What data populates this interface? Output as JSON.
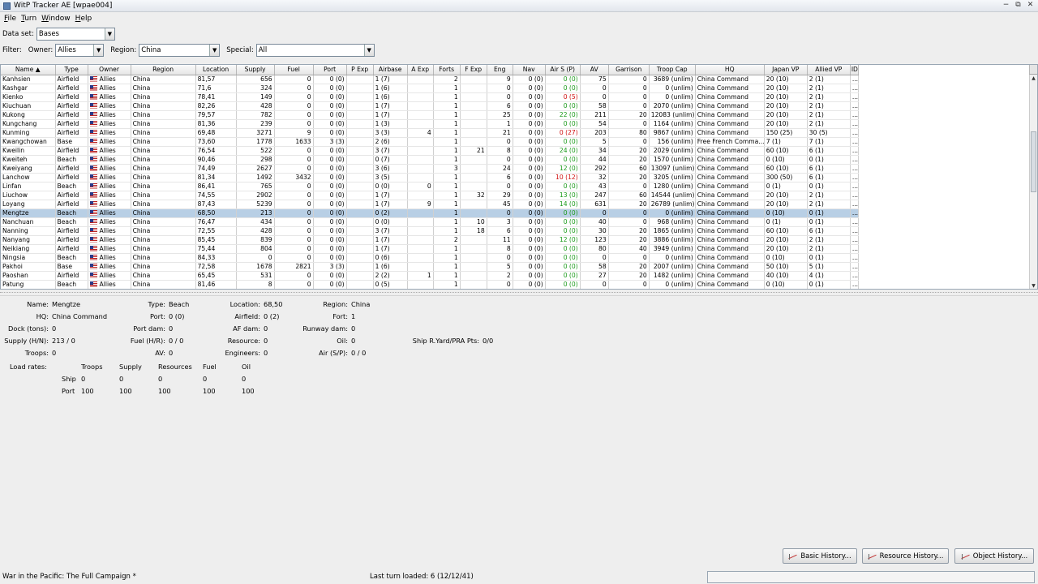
{
  "window": {
    "title": "WitP Tracker AE [wpae004]"
  },
  "menu": {
    "items": [
      "File",
      "Turn",
      "Window",
      "Help"
    ]
  },
  "dataset": {
    "label": "Data set:",
    "value": "Bases"
  },
  "filter": {
    "label": "Filter:",
    "owner_label": "Owner:",
    "owner_value": "Allies",
    "region_label": "Region:",
    "region_value": "China",
    "special_label": "Special:",
    "special_value": "All"
  },
  "table": {
    "columns": [
      "Name ▲",
      "Type",
      "Owner",
      "Region",
      "Location",
      "Supply",
      "Fuel",
      "Port",
      "P Exp",
      "Airbase",
      "A Exp",
      "Forts",
      "F Exp",
      "Eng",
      "Nav",
      "Air S (P)",
      "AV",
      "Garrison",
      "Troop Cap",
      "HQ",
      "Japan VP",
      "Allied VP",
      "ID"
    ],
    "rows": [
      [
        "Kanhsien",
        "Airfield",
        "Allies",
        "China",
        "81,57",
        "656",
        "0",
        "0 (0)",
        "",
        "1 (7)",
        "",
        "2",
        "",
        "9",
        "0 (0)",
        "0 (0)",
        "75",
        "0",
        "3689 (unlim)",
        "China Command",
        "20 (10)",
        "2 (1)",
        "..."
      ],
      [
        "Kashgar",
        "Airfield",
        "Allies",
        "China",
        "71,6",
        "324",
        "0",
        "0 (0)",
        "",
        "1 (6)",
        "",
        "1",
        "",
        "0",
        "0 (0)",
        "0 (0)",
        "0",
        "0",
        "0 (unlim)",
        "China Command",
        "20 (10)",
        "2 (1)",
        "..."
      ],
      [
        "Kienko",
        "Airfield",
        "Allies",
        "China",
        "78,41",
        "149",
        "0",
        "0 (0)",
        "",
        "1 (6)",
        "",
        "1",
        "",
        "0",
        "0 (0)",
        "0 (5)",
        "0",
        "0",
        "0 (unlim)",
        "China Command",
        "20 (10)",
        "2 (1)",
        "..."
      ],
      [
        "Kiuchuan",
        "Airfield",
        "Allies",
        "China",
        "82,26",
        "428",
        "0",
        "0 (0)",
        "",
        "1 (7)",
        "",
        "1",
        "",
        "6",
        "0 (0)",
        "0 (0)",
        "58",
        "0",
        "2070 (unlim)",
        "China Command",
        "20 (10)",
        "2 (1)",
        "..."
      ],
      [
        "Kukong",
        "Airfield",
        "Allies",
        "China",
        "79,57",
        "782",
        "0",
        "0 (0)",
        "",
        "1 (7)",
        "",
        "1",
        "",
        "25",
        "0 (0)",
        "22 (0)",
        "211",
        "20",
        "12083 (unlim)",
        "China Command",
        "20 (10)",
        "2 (1)",
        "..."
      ],
      [
        "Kungchang",
        "Airfield",
        "Allies",
        "China",
        "81,36",
        "239",
        "0",
        "0 (0)",
        "",
        "1 (3)",
        "",
        "1",
        "",
        "1",
        "0 (0)",
        "0 (0)",
        "54",
        "0",
        "1164 (unlim)",
        "China Command",
        "20 (10)",
        "2 (1)",
        "..."
      ],
      [
        "Kunming",
        "Airfield",
        "Allies",
        "China",
        "69,48",
        "3271",
        "9",
        "0 (0)",
        "",
        "3 (3)",
        "4",
        "1",
        "",
        "21",
        "0 (0)",
        "0 (27)",
        "203",
        "80",
        "9867 (unlim)",
        "China Command",
        "150 (25)",
        "30 (5)",
        "..."
      ],
      [
        "Kwangchowan",
        "Base",
        "Allies",
        "China",
        "73,60",
        "1778",
        "1633",
        "3 (3)",
        "",
        "2 (6)",
        "",
        "1",
        "",
        "0",
        "0 (0)",
        "0 (0)",
        "5",
        "0",
        "156 (unlim)",
        "Free French Comma...",
        "7 (1)",
        "7 (1)",
        "..."
      ],
      [
        "Kweilin",
        "Airfield",
        "Allies",
        "China",
        "76,54",
        "522",
        "0",
        "0 (0)",
        "",
        "3 (7)",
        "",
        "1",
        "21",
        "8",
        "0 (0)",
        "24 (0)",
        "34",
        "20",
        "2029 (unlim)",
        "China Command",
        "60 (10)",
        "6 (1)",
        "..."
      ],
      [
        "Kweiteh",
        "Beach",
        "Allies",
        "China",
        "90,46",
        "298",
        "0",
        "0 (0)",
        "",
        "0 (7)",
        "",
        "1",
        "",
        "0",
        "0 (0)",
        "0 (0)",
        "44",
        "20",
        "1570 (unlim)",
        "China Command",
        "0 (10)",
        "0 (1)",
        "..."
      ],
      [
        "Kweiyang",
        "Airfield",
        "Allies",
        "China",
        "74,49",
        "2627",
        "0",
        "0 (0)",
        "",
        "3 (6)",
        "",
        "3",
        "",
        "24",
        "0 (0)",
        "12 (0)",
        "292",
        "60",
        "13097 (unlim)",
        "China Command",
        "60 (10)",
        "6 (1)",
        "..."
      ],
      [
        "Lanchow",
        "Airfield",
        "Allies",
        "China",
        "81,34",
        "1492",
        "3432",
        "0 (0)",
        "",
        "3 (5)",
        "",
        "1",
        "",
        "6",
        "0 (0)",
        "10 (12)",
        "32",
        "20",
        "3205 (unlim)",
        "China Command",
        "300 (50)",
        "6 (1)",
        "..."
      ],
      [
        "Linfan",
        "Beach",
        "Allies",
        "China",
        "86,41",
        "765",
        "0",
        "0 (0)",
        "",
        "0 (0)",
        "0",
        "1",
        "",
        "0",
        "0 (0)",
        "0 (0)",
        "43",
        "0",
        "1280 (unlim)",
        "China Command",
        "0 (1)",
        "0 (1)",
        "..."
      ],
      [
        "Liuchow",
        "Airfield",
        "Allies",
        "China",
        "74,55",
        "2902",
        "0",
        "0 (0)",
        "",
        "1 (7)",
        "",
        "1",
        "32",
        "29",
        "0 (0)",
        "13 (0)",
        "247",
        "60",
        "14544 (unlim)",
        "China Command",
        "20 (10)",
        "2 (1)",
        "..."
      ],
      [
        "Loyang",
        "Airfield",
        "Allies",
        "China",
        "87,43",
        "5239",
        "0",
        "0 (0)",
        "",
        "1 (7)",
        "9",
        "1",
        "",
        "45",
        "0 (0)",
        "14 (0)",
        "631",
        "20",
        "26789 (unlim)",
        "China Command",
        "20 (10)",
        "2 (1)",
        "..."
      ],
      [
        "Mengtze",
        "Beach",
        "Allies",
        "China",
        "68,50",
        "213",
        "0",
        "0 (0)",
        "",
        "0 (2)",
        "",
        "1",
        "",
        "0",
        "0 (0)",
        "0 (0)",
        "0",
        "0",
        "0 (unlim)",
        "China Command",
        "0 (10)",
        "0 (1)",
        "..."
      ],
      [
        "Nanchuan",
        "Beach",
        "Allies",
        "China",
        "76,47",
        "434",
        "0",
        "0 (0)",
        "",
        "0 (0)",
        "",
        "1",
        "10",
        "3",
        "0 (0)",
        "0 (0)",
        "40",
        "0",
        "968 (unlim)",
        "China Command",
        "0 (1)",
        "0 (1)",
        "..."
      ],
      [
        "Nanning",
        "Airfield",
        "Allies",
        "China",
        "72,55",
        "428",
        "0",
        "0 (0)",
        "",
        "3 (7)",
        "",
        "1",
        "18",
        "6",
        "0 (0)",
        "0 (0)",
        "30",
        "20",
        "1865 (unlim)",
        "China Command",
        "60 (10)",
        "6 (1)",
        "..."
      ],
      [
        "Nanyang",
        "Airfield",
        "Allies",
        "China",
        "85,45",
        "839",
        "0",
        "0 (0)",
        "",
        "1 (7)",
        "",
        "2",
        "",
        "11",
        "0 (0)",
        "12 (0)",
        "123",
        "20",
        "3886 (unlim)",
        "China Command",
        "20 (10)",
        "2 (1)",
        "..."
      ],
      [
        "Neikiang",
        "Airfield",
        "Allies",
        "China",
        "75,44",
        "804",
        "0",
        "0 (0)",
        "",
        "1 (7)",
        "",
        "1",
        "",
        "8",
        "0 (0)",
        "0 (0)",
        "80",
        "40",
        "3949 (unlim)",
        "China Command",
        "20 (10)",
        "2 (1)",
        "..."
      ],
      [
        "Ningsia",
        "Beach",
        "Allies",
        "China",
        "84,33",
        "0",
        "0",
        "0 (0)",
        "",
        "0 (6)",
        "",
        "1",
        "",
        "0",
        "0 (0)",
        "0 (0)",
        "0",
        "0",
        "0 (unlim)",
        "China Command",
        "0 (10)",
        "0 (1)",
        "..."
      ],
      [
        "Pakhoi",
        "Base",
        "Allies",
        "China",
        "72,58",
        "1678",
        "2821",
        "3 (3)",
        "",
        "1 (6)",
        "",
        "1",
        "",
        "5",
        "0 (0)",
        "0 (0)",
        "58",
        "20",
        "2007 (unlim)",
        "China Command",
        "50 (10)",
        "5 (1)",
        "..."
      ],
      [
        "Paoshan",
        "Airfield",
        "Allies",
        "China",
        "65,45",
        "531",
        "0",
        "0 (0)",
        "",
        "2 (2)",
        "1",
        "1",
        "",
        "2",
        "0 (0)",
        "0 (0)",
        "27",
        "20",
        "1482 (unlim)",
        "China Command",
        "40 (10)",
        "4 (1)",
        "..."
      ],
      [
        "Patung",
        "Beach",
        "Allies",
        "China",
        "81,46",
        "8",
        "0",
        "0 (0)",
        "",
        "0 (5)",
        "",
        "1",
        "",
        "0",
        "0 (0)",
        "0 (0)",
        "0",
        "0",
        "0 (unlim)",
        "China Command",
        "0 (10)",
        "0 (1)",
        "..."
      ],
      [
        "Pingsiang",
        "Beach",
        "Allies",
        "China",
        "82,54",
        "1",
        "0",
        "0 (0)",
        "",
        "0 (6)",
        "",
        "1",
        "",
        "0",
        "0 (0)",
        "0 (0)",
        "0",
        "0",
        "0 (unlim)",
        "China Command",
        "0 (10)",
        "0 (1)",
        "..."
      ]
    ],
    "selected_row": 15,
    "airs_colors": {
      "0": "green",
      "1": "green",
      "2": "red",
      "3": "green",
      "4": "green",
      "5": "green",
      "6": "red",
      "7": "green",
      "8": "green",
      "9": "green",
      "10": "green",
      "11": "red",
      "12": "green",
      "13": "green",
      "14": "green",
      "15": "green",
      "16": "green",
      "17": "green",
      "18": "green",
      "19": "green",
      "20": "green",
      "21": "green",
      "22": "green",
      "23": "green",
      "24": "green"
    }
  },
  "detail": {
    "name_label": "Name:",
    "name": "Mengtze",
    "type_label": "Type:",
    "type": "Beach",
    "location_label": "Location:",
    "location": "68,50",
    "region_label": "Region:",
    "region": "China",
    "hq_label": "HQ:",
    "hq": "China Command",
    "port_label": "Port:",
    "port": "0 (0)",
    "airfield_label": "Airfield:",
    "airfield": "0 (2)",
    "fort_label": "Fort:",
    "fort": "1",
    "dock_label": "Dock (tons):",
    "dock": "0",
    "portdam_label": "Port dam:",
    "portdam": "0",
    "afdam_label": "AF dam:",
    "afdam": "0",
    "runwaydam_label": "Runway dam:",
    "runwaydam": "0",
    "supply_label": "Supply (H/N):",
    "supply": "213 / 0",
    "fuel_label": "Fuel (H/R):",
    "fuel": "0 / 0",
    "resource_label": "Resource:",
    "resource": "0",
    "oil_label": "Oil:",
    "oil": "0",
    "shipyard_label": "Ship R.Yard/PRA Pts:",
    "shipyard": "0/0",
    "troops_label": "Troops:",
    "troops": "0",
    "av_label": "AV:",
    "av": "0",
    "engineers_label": "Engineers:",
    "engineers": "0",
    "air_label": "Air (S/P):",
    "air": "0 / 0",
    "load_rates_label": "Load rates:",
    "lr_headers": [
      "Troops",
      "Supply",
      "Resources",
      "Fuel",
      "Oil"
    ],
    "lr_rows": [
      {
        "label": "Ship",
        "values": [
          "0",
          "0",
          "0",
          "0",
          "0"
        ]
      },
      {
        "label": "Port",
        "values": [
          "100",
          "100",
          "100",
          "100",
          "100"
        ]
      }
    ]
  },
  "buttons": {
    "basic": "Basic History...",
    "resource": "Resource History...",
    "object": "Object History..."
  },
  "status": {
    "left": "War in the Pacific: The Full Campaign  *",
    "mid": "Last turn loaded: 6 (12/12/41)"
  }
}
